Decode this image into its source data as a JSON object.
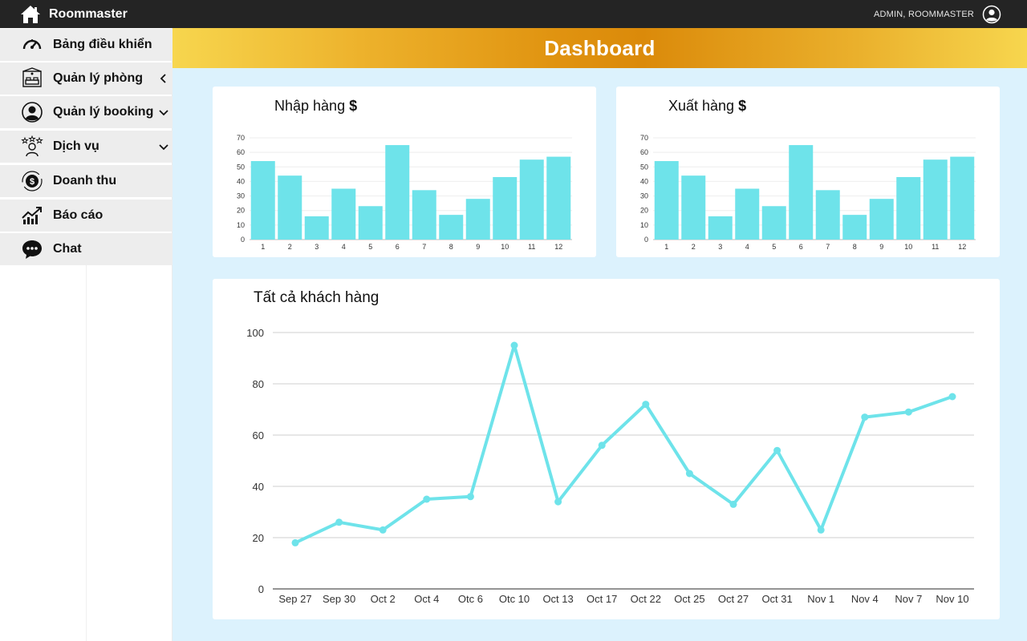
{
  "app": {
    "name": "Roommaster",
    "user": "ADMIN, ROOMMASTER"
  },
  "sidebar": {
    "items": [
      {
        "label": "Bảng điều khiển",
        "icon": "speedometer-icon",
        "chevron": ""
      },
      {
        "label": "Quản lý phòng",
        "icon": "room-icon",
        "chevron": "left"
      },
      {
        "label": "Quản lý booking",
        "icon": "user-circle-icon",
        "chevron": "down"
      },
      {
        "label": "Dịch vụ",
        "icon": "service-stars-icon",
        "chevron": "down"
      },
      {
        "label": "Doanh thu",
        "icon": "revenue-coin-icon",
        "chevron": ""
      },
      {
        "label": "Báo cáo",
        "icon": "trend-chart-icon",
        "chevron": ""
      },
      {
        "label": "Chat",
        "icon": "chat-bubble-icon",
        "chevron": ""
      }
    ]
  },
  "page": {
    "title": "Dashboard"
  },
  "cards": {
    "import": {
      "title": "Nhập hàng",
      "currency": "$"
    },
    "export": {
      "title": "Xuất hàng",
      "currency": "$"
    },
    "customers": {
      "title": "Tất cả khách hàng"
    }
  },
  "colors": {
    "accent": "#6ee3ea",
    "topbar": "#242424",
    "background": "#dcf2fd",
    "banner": "#db8a0a"
  },
  "chart_data": [
    {
      "type": "bar",
      "title": "Nhập hàng $",
      "categories": [
        "1",
        "2",
        "3",
        "4",
        "5",
        "6",
        "7",
        "8",
        "9",
        "10",
        "11",
        "12"
      ],
      "values": [
        54,
        44,
        16,
        35,
        23,
        65,
        34,
        17,
        28,
        43,
        55,
        57
      ],
      "ylim": [
        0,
        70
      ],
      "yticks": [
        0,
        10,
        20,
        30,
        40,
        50,
        60,
        70
      ],
      "grid": true
    },
    {
      "type": "bar",
      "title": "Xuất hàng $",
      "categories": [
        "1",
        "2",
        "3",
        "4",
        "5",
        "6",
        "7",
        "8",
        "9",
        "10",
        "11",
        "12"
      ],
      "values": [
        54,
        44,
        16,
        35,
        23,
        65,
        34,
        17,
        28,
        43,
        55,
        57
      ],
      "ylim": [
        0,
        70
      ],
      "yticks": [
        0,
        10,
        20,
        30,
        40,
        50,
        60,
        70
      ],
      "grid": true
    },
    {
      "type": "line",
      "title": "Tất cả khách hàng",
      "x": [
        "Sep 27",
        "Sep 30",
        "Oct 2",
        "Oct 4",
        "Otc 6",
        "Otc 10",
        "Oct 13",
        "Oct 17",
        "Oct 22",
        "Oct 25",
        "Oct 27",
        "Oct 31",
        "Nov 1",
        "Nov 4",
        "Nov 7",
        "Nov 10"
      ],
      "values": [
        18,
        26,
        23,
        35,
        36,
        95,
        34,
        56,
        72,
        45,
        33,
        54,
        23,
        67,
        69,
        75
      ],
      "ylim": [
        0,
        100
      ],
      "yticks": [
        0,
        20,
        40,
        60,
        80,
        100
      ],
      "grid": true
    }
  ]
}
